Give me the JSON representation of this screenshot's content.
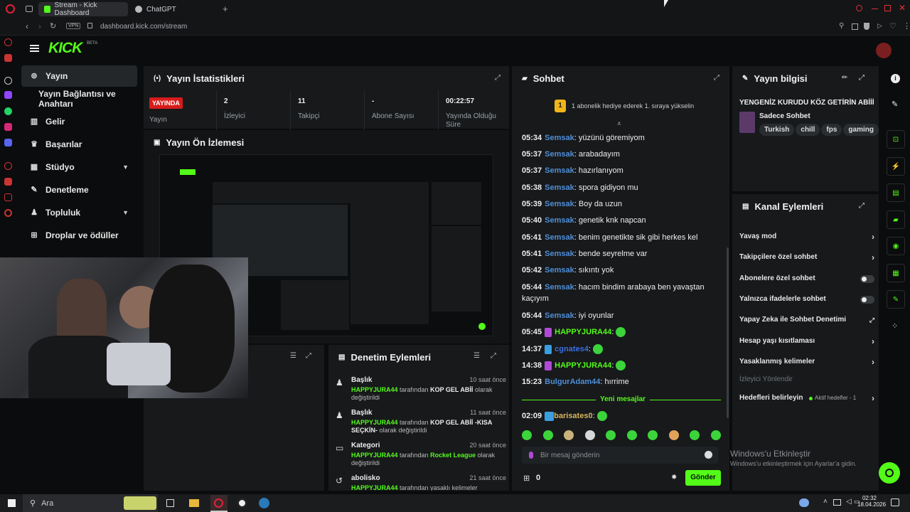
{
  "browser": {
    "tabs": [
      {
        "label": "Stream - Kick Dashboard",
        "active": true
      },
      {
        "label": "ChatGPT",
        "active": false
      }
    ],
    "new_tab": "+",
    "vpn_badge": "VPN",
    "url": "dashboard.kick.com/stream"
  },
  "header": {
    "logo": "KICK",
    "logo_beta": "BETA"
  },
  "sidebar": {
    "items": [
      {
        "label": "Yayın",
        "icon": "broadcast-icon",
        "active": true
      },
      {
        "label": "Yayın Bağlantısı ve Anahtarı",
        "icon": "",
        "active": false
      },
      {
        "label": "Gelir",
        "icon": "chart-icon",
        "active": false
      },
      {
        "label": "Başarılar",
        "icon": "trophy-icon",
        "active": false
      },
      {
        "label": "Stüdyo",
        "icon": "layout-icon",
        "active": false,
        "expandable": true
      },
      {
        "label": "Denetleme",
        "icon": "wrench-icon",
        "active": false
      },
      {
        "label": "Topluluk",
        "icon": "users-icon",
        "active": false,
        "expandable": true
      },
      {
        "label": "Droplar ve ödüller",
        "icon": "gift-icon",
        "active": false
      }
    ]
  },
  "stats": {
    "title": "Yayın İstatistikleri",
    "live_badge": "YAYINDA",
    "stream_label": "Yayın",
    "viewers_value": "2",
    "viewers_label": "İzleyici",
    "followers_value": "11",
    "followers_label": "Takipçi",
    "subs_value": "-",
    "subs_label": "Abone Sayısı",
    "uptime_value": "00:22:57",
    "uptime_label": "Yayında Olduğu Süre"
  },
  "preview": {
    "title": "Yayın Ön İzlemesi"
  },
  "moderation": {
    "title": "Denetim Eylemleri",
    "items": [
      {
        "heading": "Başlık",
        "time": "10 saat önce",
        "user": "HAPPYJURA44",
        "mid": " tarafından ",
        "value": "KOP GEL ABİİ",
        "suffix": " olarak değiştirildi",
        "icon": "users-icon"
      },
      {
        "heading": "Başlık",
        "time": "11 saat önce",
        "user": "HAPPYJURA44",
        "mid": " tarafından ",
        "value": "KOP GEL ABİİ -KISA SEÇKİN-",
        "suffix": " olarak değiştirildi",
        "icon": "users-icon"
      },
      {
        "heading": "Kategori",
        "time": "20 saat önce",
        "user": "HAPPYJURA44",
        "mid": " tarafından ",
        "value": "Rocket League",
        "suffix": " olarak değiştirildi",
        "icon": "category-icon"
      },
      {
        "heading": "abolisko",
        "time": "21 saat önce",
        "user": "HAPPYJURA44",
        "mid": " tarafından ",
        "value": "yasaklı kelimeler",
        "suffix": "",
        "icon": "history-icon"
      }
    ]
  },
  "chat": {
    "title": "Sohbet",
    "pinned": "1 abonelik hediye ederek 1. sıraya yükselin",
    "pinned_rank": "1",
    "messages": [
      {
        "time": "05:34",
        "user": "Semsak",
        "text": "yüzünü göremiyom",
        "color": "#4e8fd9"
      },
      {
        "time": "05:37",
        "user": "Semsak",
        "text": "arabadayım",
        "color": "#4e8fd9"
      },
      {
        "time": "05:37",
        "user": "Semsak",
        "text": "hazırlanıyom",
        "color": "#4e8fd9"
      },
      {
        "time": "05:38",
        "user": "Semsak",
        "text": "spora gidiyon mu",
        "color": "#4e8fd9"
      },
      {
        "time": "05:39",
        "user": "Semsak",
        "text": "Boy da uzun",
        "color": "#4e8fd9"
      },
      {
        "time": "05:40",
        "user": "Semsak",
        "text": "genetik knk napcan",
        "color": "#4e8fd9"
      },
      {
        "time": "05:41",
        "user": "Semsak",
        "text": "benim genetikte sik gibi herkes kel",
        "color": "#4e8fd9"
      },
      {
        "time": "05:41",
        "user": "Semsak",
        "text": "bende seyrelme var",
        "color": "#4e8fd9"
      },
      {
        "time": "05:42",
        "user": "Semsak",
        "text": "sıkıntı yok",
        "color": "#4e8fd9"
      },
      {
        "time": "05:44",
        "user": "Semsak",
        "text": "hacım bindim arabaya ben yavaştan kaçıyım",
        "color": "#4e8fd9"
      },
      {
        "time": "05:44",
        "user": "Semsak",
        "text": "iyi oyunlar",
        "color": "#4e8fd9"
      },
      {
        "time": "05:45",
        "user": "HAPPYJURA44",
        "text": "",
        "color": "#53fc18"
      },
      {
        "time": "14:37",
        "user": "cgnates4",
        "text": "",
        "color": "#3b6fe0"
      },
      {
        "time": "14:38",
        "user": "HAPPYJURA44",
        "text": "",
        "color": "#53fc18"
      },
      {
        "time": "15:23",
        "user": "BulgurAdam44",
        "text": "hırrime",
        "color": "#4e8fd9"
      }
    ],
    "new_messages": "Yeni mesajlar",
    "last_message": {
      "time": "02:09",
      "user": "barisates0",
      "text": "",
      "color": "#d8b55c"
    },
    "input_placeholder": "Bir mesaj gönderin",
    "points": "0",
    "send_label": "Gönder"
  },
  "stream_info": {
    "title": "Yayın bilgisi",
    "stream_title": "YENGENİZ KURUDU KÖZ GETİRİN ABİİİ",
    "category": "Sadece Sohbet",
    "tags": [
      "Turkish",
      "chill",
      "fps",
      "gaming"
    ]
  },
  "channel_actions": {
    "title": "Kanal Eylemleri",
    "items": [
      {
        "label": "Yavaş mod",
        "control": "chevron"
      },
      {
        "label": "Takipçilere özel sohbet",
        "control": "chevron"
      },
      {
        "label": "Abonelere özel sohbet",
        "control": "toggle"
      },
      {
        "label": "Yalnızca ifadelerle sohbet",
        "control": "toggle"
      },
      {
        "label": "Yapay Zeka ile Sohbet Denetimi",
        "control": "external"
      },
      {
        "label": "Hesap yaşı kısıtlaması",
        "control": "chevron"
      },
      {
        "label": "Yasaklanmış kelimeler",
        "control": "chevron"
      }
    ],
    "section_label": "İzleyici Yönlendir",
    "goals_label": "Hedefleri belirleyin",
    "goals_status": "Aktif hedefler - 1"
  },
  "windows_watermark": {
    "line1": "Windows'u Etkinleştir",
    "line2": "Windows'u etkinleştirmek için Ayarlar'a gidin."
  },
  "taskbar": {
    "search_placeholder": "Ara",
    "time": "02:32",
    "date": "18.04.2026"
  },
  "colors": {
    "accent": "#53fc18",
    "panel": "#17191b",
    "bg": "#0b0c0d",
    "live": "#d61c1c"
  }
}
